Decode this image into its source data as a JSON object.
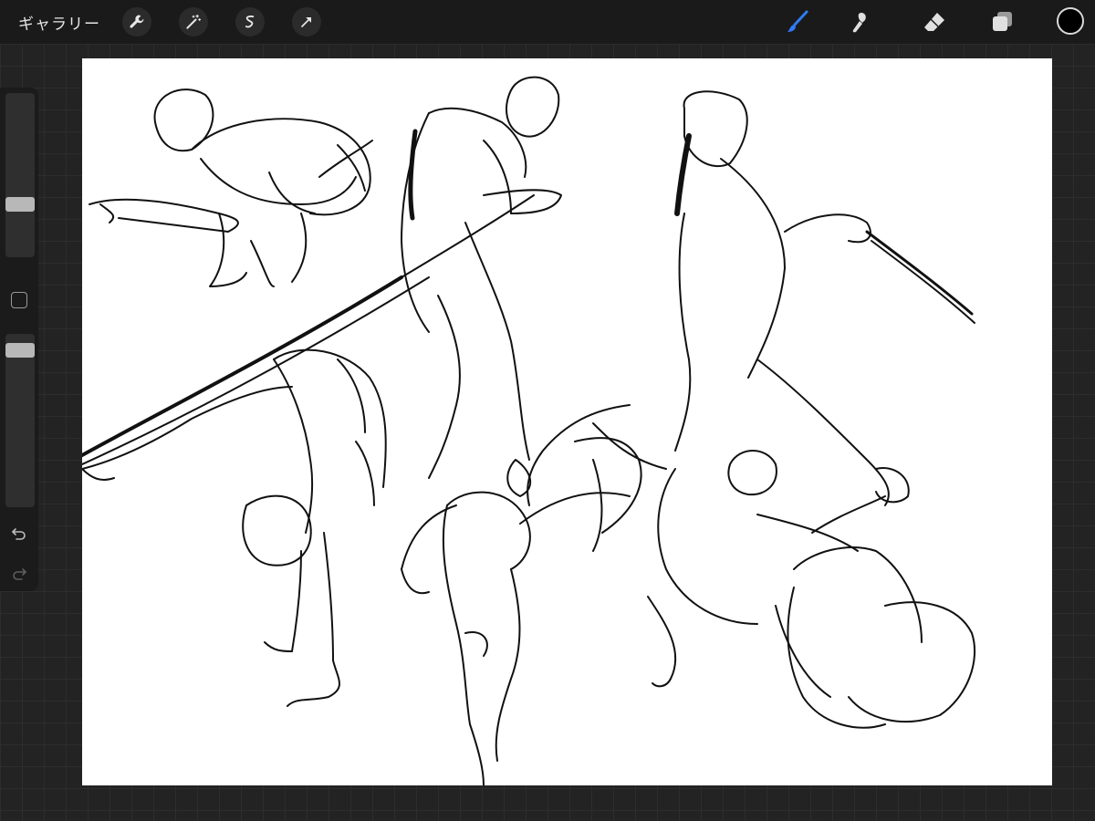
{
  "toolbar": {
    "gallery_label": "ギャラリー",
    "left_tools": [
      {
        "icon": "wrench-icon"
      },
      {
        "icon": "magic-wand-icon"
      },
      {
        "icon": "selection-icon"
      },
      {
        "icon": "transform-arrow-icon"
      }
    ],
    "right_tools": [
      {
        "icon": "brush-icon",
        "active": true
      },
      {
        "icon": "smudge-icon"
      },
      {
        "icon": "eraser-icon"
      },
      {
        "icon": "layers-icon"
      }
    ],
    "current_color": "#000000",
    "accent_color": "#2f7bf5"
  },
  "sidebar": {
    "brush_size_icon": "slider-handle",
    "modify_icon": "square-icon",
    "opacity_icon": "slider-handle",
    "undo_icon": "undo-arrow-icon",
    "redo_icon": "redo-arrow-icon"
  }
}
